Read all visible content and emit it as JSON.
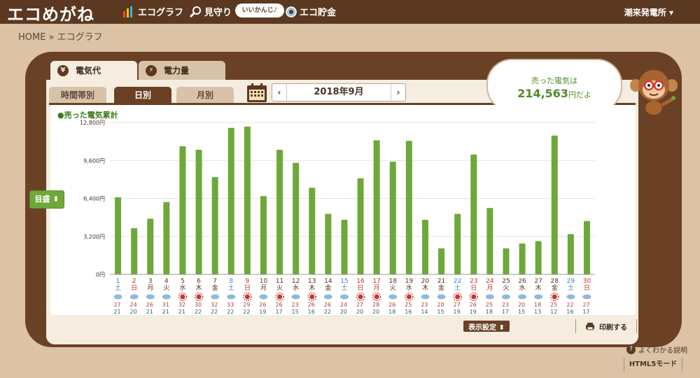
{
  "header": {
    "brand": "エコめがね",
    "nav": [
      {
        "label": "エコグラフ",
        "icon": "bar-graph-icon"
      },
      {
        "label": "見守り",
        "icon": "magnifier-icon"
      },
      {
        "label": "エコ貯金",
        "icon": "coin-icon"
      }
    ],
    "badge": "いいかんじ♪",
    "station": "潮来発電所 ▾"
  },
  "breadcrumb": "HOME » エコグラフ",
  "tabs": [
    {
      "label": "電気代",
      "icon": "yen-icon",
      "active": true
    },
    {
      "label": "電力量",
      "icon": "bolt-icon",
      "active": false
    }
  ],
  "subtabs": [
    {
      "label": "時間帯別",
      "active": false
    },
    {
      "label": "日別",
      "active": true
    },
    {
      "label": "月別",
      "active": false
    }
  ],
  "date_nav": {
    "prev": "‹",
    "current": "2018年9月",
    "next": "›"
  },
  "summary": {
    "line1": "売った電気は",
    "amount": "214,563",
    "suffix": "円だよ"
  },
  "legend_label": "●売った電気累計",
  "scale_button": "目盛 ⬍",
  "display_settings": "表示設定 ⬍",
  "print_button": "印刷する",
  "help_link": "よくわかる説明",
  "html5_mode": "HTML5モード",
  "colors": {
    "bar": "#6fa83a",
    "saturday": "#4a7cc9",
    "sunday": "#d02b2b",
    "weekday": "#4a3524"
  },
  "chart_data": {
    "type": "bar",
    "title": "",
    "ylim": [
      0,
      12800
    ],
    "ytick_values": [
      0,
      3200,
      6400,
      9600,
      12800
    ],
    "ytick_labels": [
      "0円",
      "3,200円",
      "6,400円",
      "9,600円",
      "12,800円"
    ],
    "categories": [
      "1",
      "2",
      "3",
      "4",
      "5",
      "6",
      "7",
      "8",
      "9",
      "10",
      "11",
      "12",
      "13",
      "14",
      "15",
      "16",
      "17",
      "18",
      "19",
      "20",
      "21",
      "22",
      "23",
      "24",
      "25",
      "26",
      "27",
      "28",
      "29",
      "30"
    ],
    "weekdays": [
      "土",
      "日",
      "月",
      "火",
      "水",
      "木",
      "金",
      "土",
      "日",
      "月",
      "火",
      "水",
      "木",
      "金",
      "土",
      "日",
      "月",
      "火",
      "水",
      "木",
      "金",
      "土",
      "日",
      "月",
      "火",
      "水",
      "木",
      "金",
      "土",
      "日"
    ],
    "day_type": [
      "sat",
      "sun",
      "wd",
      "wd",
      "wd",
      "wd",
      "wd",
      "sat",
      "sun",
      "wd",
      "wd",
      "wd",
      "wd",
      "wd",
      "sat",
      "sun",
      "sun",
      "wd",
      "wd",
      "wd",
      "wd",
      "sat",
      "sun",
      "sun",
      "wd",
      "wd",
      "wd",
      "wd",
      "sat",
      "sun"
    ],
    "weather": [
      "cloud",
      "cloud",
      "cloud",
      "cloud",
      "sun",
      "sun",
      "cloud",
      "cloud",
      "sun",
      "cloud",
      "sun",
      "cloud",
      "sun",
      "cloud",
      "cloud",
      "sun",
      "sun",
      "cloud",
      "sun",
      "cloud",
      "cloud",
      "sun",
      "sun",
      "cloud",
      "cloud",
      "cloud",
      "cloud",
      "sun",
      "cloud",
      "cloud"
    ],
    "temp_high": [
      27,
      24,
      26,
      31,
      32,
      30,
      32,
      33,
      29,
      26,
      26,
      23,
      26,
      26,
      24,
      27,
      28,
      26,
      25,
      23,
      20,
      27,
      26,
      25,
      23,
      20,
      18,
      25,
      22,
      27
    ],
    "temp_low": [
      21,
      20,
      21,
      21,
      21,
      22,
      22,
      22,
      22,
      19,
      17,
      15,
      16,
      22,
      20,
      20,
      20,
      18,
      16,
      14,
      15,
      19,
      19,
      18,
      17,
      15,
      13,
      12,
      16,
      17
    ],
    "values": [
      6500,
      3900,
      4700,
      6100,
      10800,
      10500,
      8200,
      12350,
      12450,
      6600,
      10500,
      9400,
      7300,
      5100,
      4600,
      8100,
      11300,
      9500,
      11250,
      4600,
      2200,
      5100,
      10100,
      5600,
      2200,
      2600,
      2800,
      11700,
      3400,
      4500
    ]
  }
}
